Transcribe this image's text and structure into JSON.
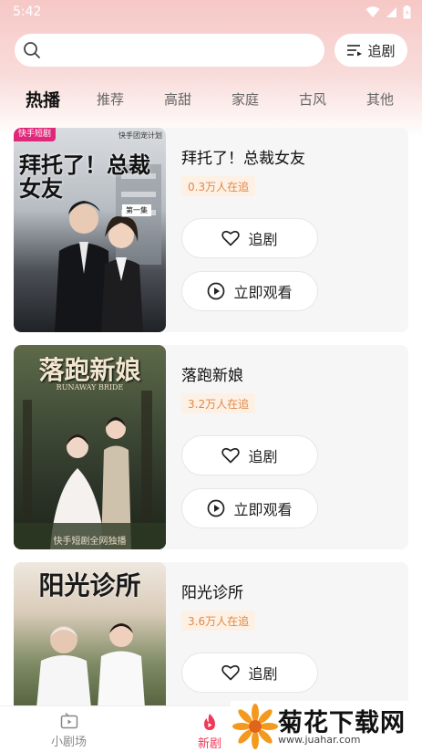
{
  "status_bar": {
    "time": "5:42"
  },
  "search": {
    "placeholder": "",
    "follow_label": "追剧"
  },
  "tabs": [
    "热播",
    "推荐",
    "高甜",
    "家庭",
    "古风",
    "其他"
  ],
  "dramas": [
    {
      "title": "拜托了！总裁女友",
      "viewers": "0.3万人在追",
      "follow_label": "追剧",
      "watch_label": "立即观看",
      "poster": {
        "title": "拜托了！总裁女友",
        "tag": "快手短剧",
        "top_text": "快手团宠计划",
        "ep_tag": "第一集"
      }
    },
    {
      "title": "落跑新娘",
      "viewers": "3.2万人在追",
      "follow_label": "追剧",
      "watch_label": "立即观看",
      "poster": {
        "title": "落跑新娘",
        "subtitle": "RUNAWAY BRIDE",
        "bottom_text": "快手短剧全网独播"
      }
    },
    {
      "title": "阳光诊所",
      "viewers": "3.6万人在追",
      "follow_label": "追剧",
      "poster": {
        "title": "阳光诊所"
      }
    }
  ],
  "bottom_nav": [
    {
      "label": "小剧场",
      "icon": "tv-icon"
    },
    {
      "label": "新剧",
      "icon": "flame-icon"
    }
  ],
  "watermark": {
    "text": "菊花下载网",
    "url": "www.juahar.com"
  },
  "colors": {
    "accent": "#f0395a",
    "badge_text": "#e0894a",
    "badge_bg": "#fdf0e4"
  }
}
